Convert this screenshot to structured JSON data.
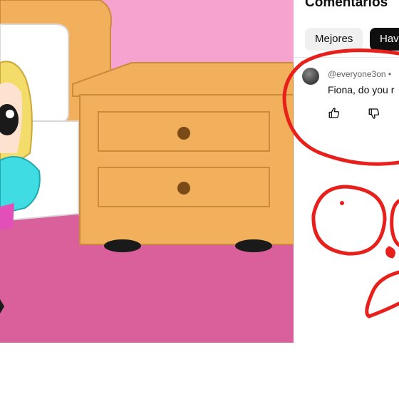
{
  "panel": {
    "title": "Comentarios",
    "chips": [
      "Mejores",
      "Hav"
    ]
  },
  "comment": {
    "author": "@everyone3on •",
    "text": "Fiona, do you r"
  },
  "icons": {
    "like": "thumbs-up-icon",
    "dislike": "thumbs-down-icon"
  },
  "colors": {
    "marker_red": "#e8201c",
    "wall_pink": "#f6a3cf",
    "floor_pink": "#d9609a",
    "dresser_orange": "#f2b05c"
  }
}
